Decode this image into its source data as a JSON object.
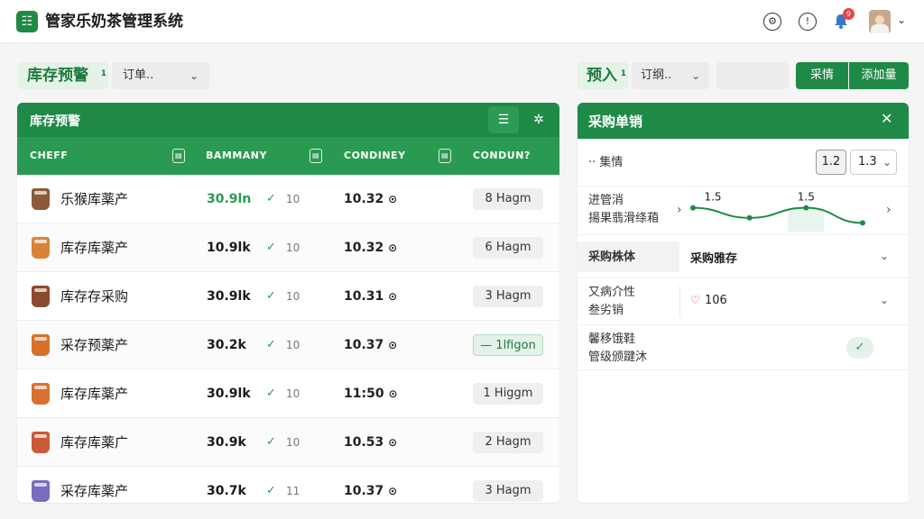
{
  "app": {
    "title": "管家乐奶茶管理系统",
    "logo_glyph": "☷"
  },
  "topbar": {
    "notif_count": "9"
  },
  "toolbar": {
    "left_title": "库存预警",
    "left_badge": "1",
    "left_select": "订单..",
    "right_title": "预入",
    "right_badge": "1",
    "right_select": "订纲..",
    "btn_a": "采情",
    "btn_b": "添加量"
  },
  "inventory": {
    "title": "库存预警",
    "columns": [
      "CHEFF",
      "BAMMANY",
      "CONDINEY",
      "CONDUN?"
    ],
    "rows": [
      {
        "name": "乐猴库薬产",
        "stock": "30.9ln",
        "count": "10",
        "time": "10.32",
        "tag": "8 Hagm",
        "cup_color": "#8a5a3b",
        "stock_color": "#2a9a52"
      },
      {
        "name": "库存库薬产",
        "stock": "10.9lk",
        "count": "10",
        "time": "10.32",
        "tag": "6 Hagm",
        "cup_color": "#d7843a",
        "stock_color": "#1a1a1a"
      },
      {
        "name": "库存存采购",
        "stock": "30.9lk",
        "count": "10",
        "time": "10.31",
        "tag": "3 Hagm",
        "cup_color": "#8b4a2f",
        "stock_color": "#1a1a1a"
      },
      {
        "name": "采存预薬产",
        "stock": "30.2k",
        "count": "10",
        "time": "10.37",
        "tag": "— 1lfigon",
        "cup_color": "#d7712a",
        "stock_color": "#1a1a1a",
        "highlight": true
      },
      {
        "name": "库存库薬产",
        "stock": "30.9lk",
        "count": "10",
        "time": "11:50",
        "tag": "1 Higgm",
        "cup_color": "#d9702f",
        "stock_color": "#1a1a1a"
      },
      {
        "name": "库存库薬广",
        "stock": "30.9k",
        "count": "10",
        "time": "10.53",
        "tag": "2 Hagm",
        "cup_color": "#c95a38",
        "stock_color": "#1a1a1a"
      },
      {
        "name": "采存库薬产",
        "stock": "30.7k",
        "count": "11",
        "time": "10.37",
        "tag": "3 Hagm",
        "cup_color": "#7b6bc0",
        "stock_color": "#1a1a1a"
      }
    ]
  },
  "purchase": {
    "title": "采购单销",
    "rows": {
      "r1": {
        "label": "·· 集情",
        "val1": "1.2",
        "val2": "1.3"
      },
      "r2": {
        "label1": "进管消",
        "label2": "揚果翡滑绦葙",
        "p1": "1.5",
        "p2": "1.5"
      },
      "r3": {
        "label": "采购株体",
        "value": "采购雅存"
      },
      "r4": {
        "label1": "又病介性",
        "label2": "叁劣销",
        "value": "106"
      },
      "r5": {
        "label1": "馨移饿鞋",
        "label2": "管级颁踺沐"
      }
    }
  },
  "chart_data": {
    "type": "line",
    "values": [
      1.5,
      1.3,
      1.5,
      1.2
    ],
    "point_labels": [
      "1.5",
      "",
      "1.5",
      ""
    ]
  },
  "colors": {
    "primary": "#1f8a47",
    "primary_light": "#e4f2e8",
    "accent_red": "#e64545"
  }
}
